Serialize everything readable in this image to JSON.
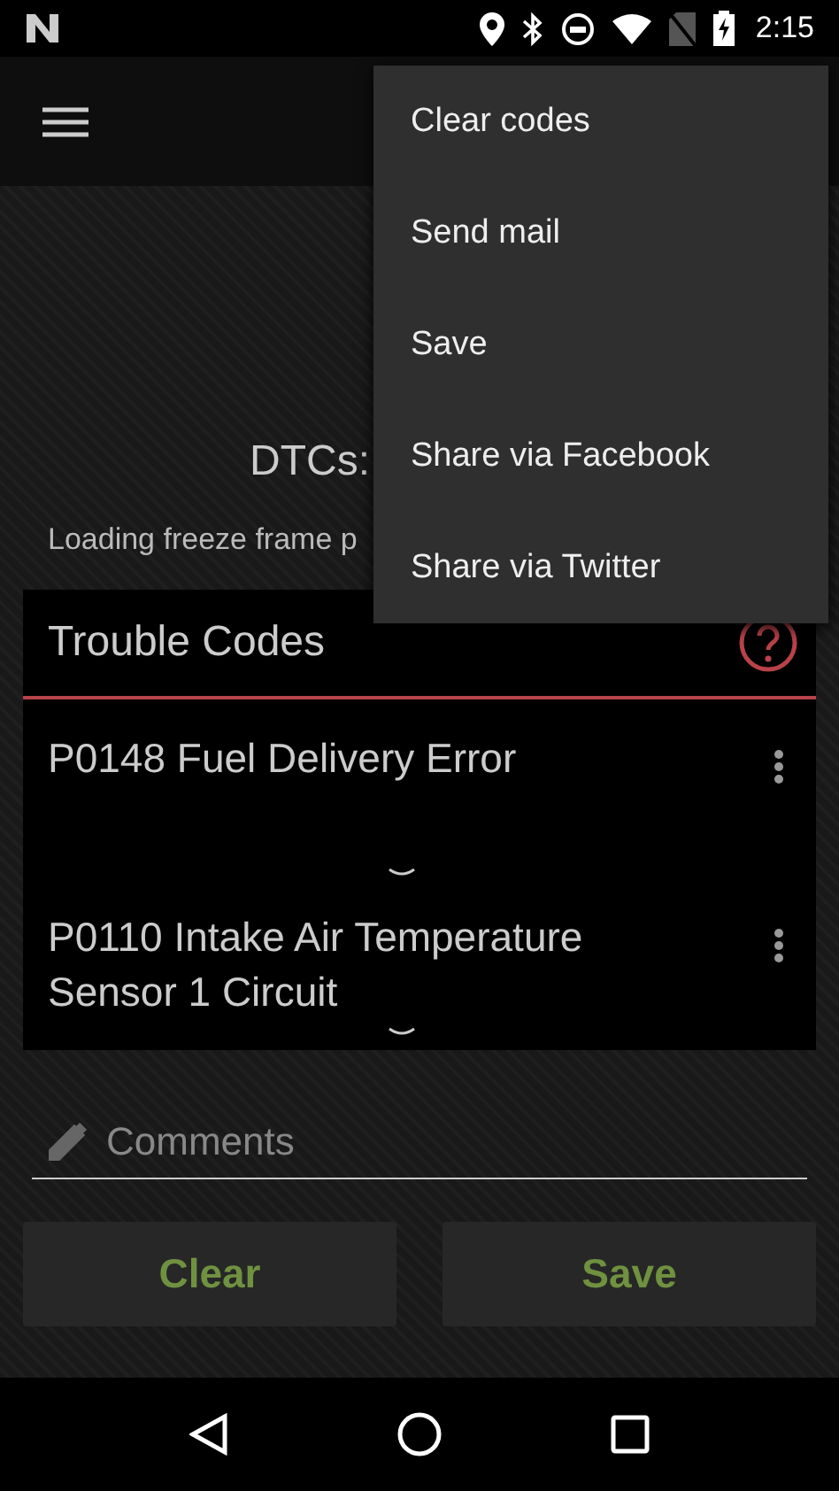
{
  "status_bar": {
    "time": "2:15"
  },
  "summary": {
    "title": "DTCs:",
    "subtitle": "Loading freeze frame p"
  },
  "trouble_codes": {
    "title": "Trouble Codes",
    "items": [
      {
        "code": "P0148",
        "description": "Fuel Delivery Error"
      },
      {
        "code": "P0110",
        "description": "Intake Air Temperature Sensor 1 Circuit"
      }
    ]
  },
  "comments": {
    "placeholder": "Comments"
  },
  "buttons": [
    {
      "label": "Clear"
    },
    {
      "label": "Save"
    }
  ],
  "menu": {
    "items": [
      "Clear codes",
      "Send mail",
      "Save",
      "Share via Facebook",
      "Share via Twitter"
    ]
  }
}
